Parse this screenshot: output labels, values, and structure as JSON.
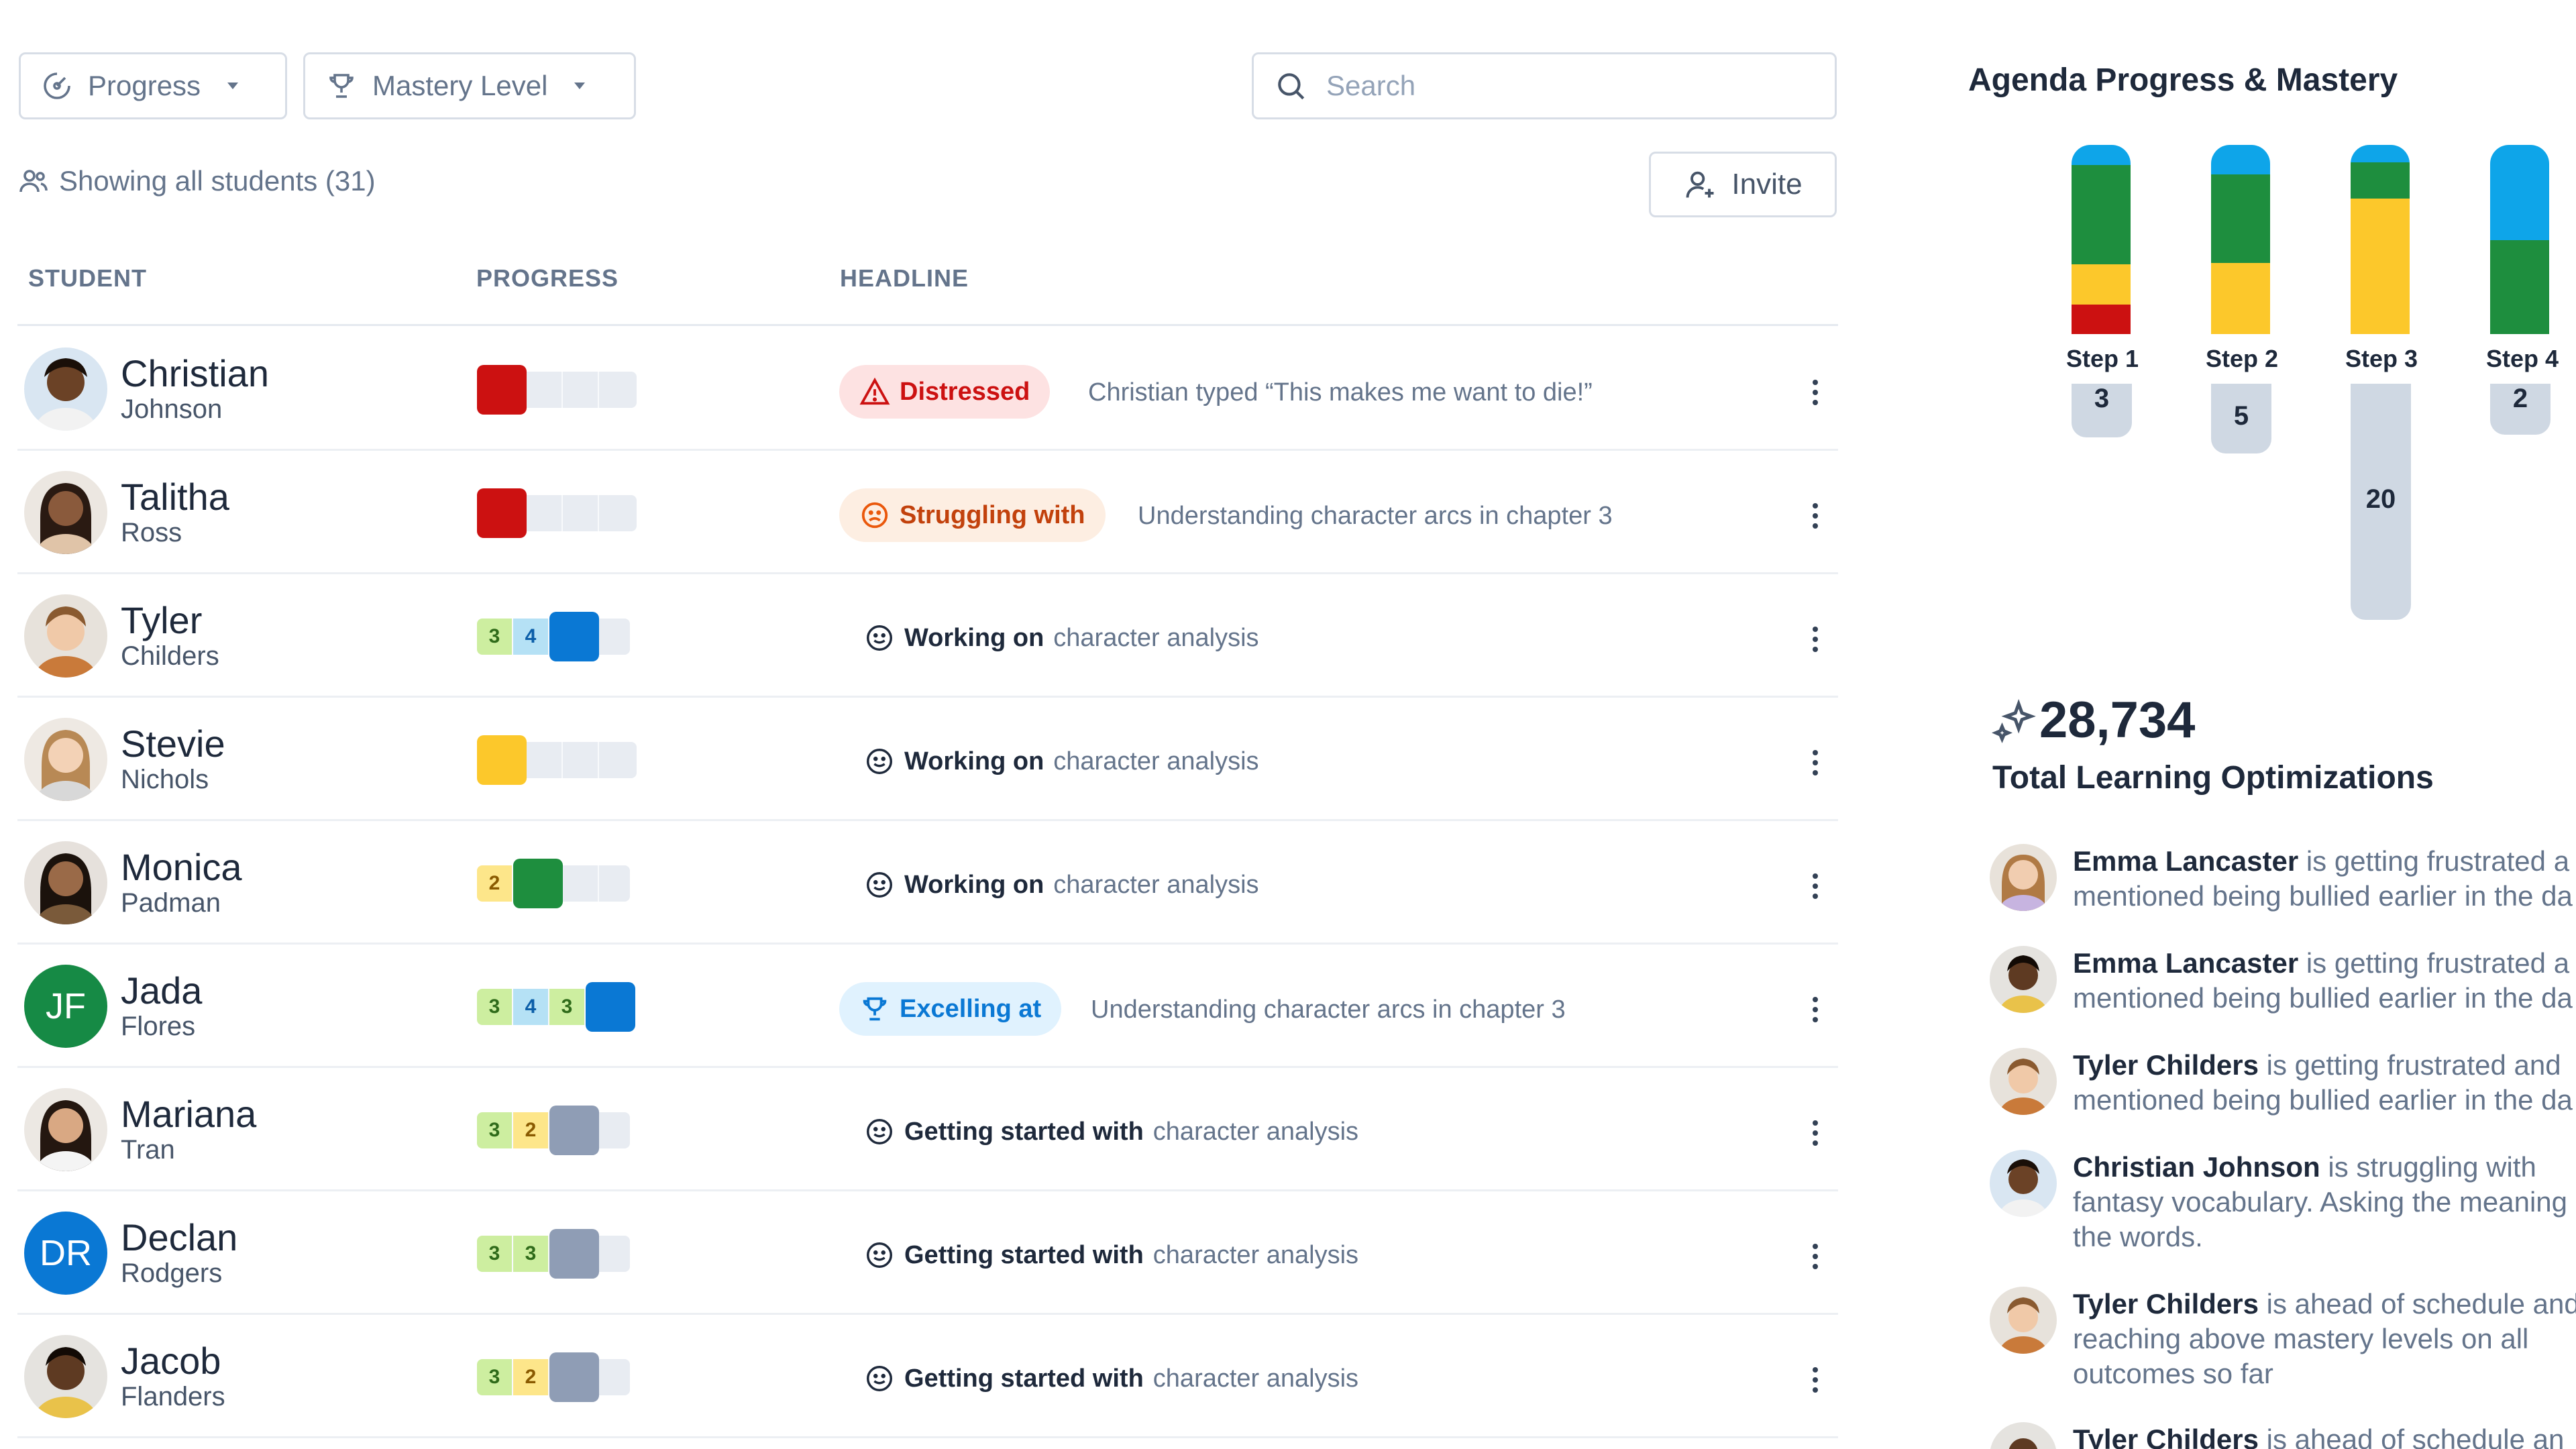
{
  "filters": {
    "progress_label": "Progress",
    "mastery_label": "Mastery Level"
  },
  "search": {
    "placeholder": "Search"
  },
  "roster": {
    "showing_label": "Showing all students (31)",
    "invite_label": "Invite"
  },
  "table": {
    "headers": {
      "student": "STUDENT",
      "progress": "PROGRESS",
      "headline": "HEADLINE"
    },
    "rows": [
      {
        "first": "Christian",
        "last": "Johnson",
        "status": "Distressed",
        "detail": "Christian typed “This makes me want to die!”"
      },
      {
        "first": "Talitha",
        "last": "Ross",
        "status": "Struggling with",
        "detail": "Understanding character arcs in chapter 3"
      },
      {
        "first": "Tyler",
        "last": "Childers",
        "status": "Working on",
        "detail": "character analysis",
        "steps": [
          "3",
          "4"
        ]
      },
      {
        "first": "Stevie",
        "last": "Nichols",
        "status": "Working on",
        "detail": "character analysis"
      },
      {
        "first": "Monica",
        "last": "Padman",
        "status": "Working on",
        "detail": "character analysis",
        "steps": [
          "2"
        ]
      },
      {
        "first": "Jada",
        "last": "Flores",
        "initials": "JF",
        "status": "Excelling at",
        "detail": "Understanding character arcs in chapter 3",
        "steps": [
          "3",
          "4",
          "3"
        ]
      },
      {
        "first": "Mariana",
        "last": "Tran",
        "status": "Getting started with",
        "detail": "character analysis",
        "steps": [
          "3",
          "2"
        ]
      },
      {
        "first": "Declan",
        "last": "Rodgers",
        "initials": "DR",
        "status": "Getting started with",
        "detail": "character analysis",
        "steps": [
          "3",
          "3"
        ]
      },
      {
        "first": "Jacob",
        "last": "Flanders",
        "status": "Getting started with",
        "detail": "character analysis",
        "steps": [
          "3",
          "2"
        ]
      }
    ]
  },
  "panel": {
    "title": "Agenda Progress & Mastery",
    "steps": [
      {
        "label": "Step 1",
        "count": "3"
      },
      {
        "label": "Step 2",
        "count": "5"
      },
      {
        "label": "Step 3",
        "count": "20"
      },
      {
        "label": "Step 4",
        "count": "2"
      }
    ],
    "total_value": "28,734",
    "total_label": "Total Learning Optimizations",
    "feed": [
      {
        "name": "Emma Lancaster",
        "text": " is getting frustrated a",
        "line2": "mentioned being bullied earlier in the da"
      },
      {
        "name": "Emma Lancaster",
        "text": " is getting frustrated a",
        "line2": "mentioned being bullied earlier in the da"
      },
      {
        "name": "Tyler Childers",
        "text": " is getting frustrated and",
        "line2": "mentioned being bullied earlier in the da"
      },
      {
        "name": "Christian Johnson",
        "text": " is struggling with",
        "line2": "fantasy vocabulary. Asking the meaning",
        "line3": "the words."
      },
      {
        "name": "Tyler Childers",
        "text": " is ahead of schedule and",
        "line2": "reaching above mastery levels on all",
        "line3": "outcomes so far"
      },
      {
        "name": "Tyler Childers",
        "text": " is ahead of schedule an"
      }
    ]
  },
  "colors": {
    "red": "#cc1111",
    "yellow": "#fcc82b",
    "green": "#1e8e3e",
    "blue": "#0a78d4",
    "gray": "#8f9db5",
    "track": "#e8ecf2",
    "light_green": "#cdeea0",
    "light_blue": "#b5e1f5",
    "light_yellow": "#fde68a",
    "accent_blue": "#0ea5e9"
  }
}
